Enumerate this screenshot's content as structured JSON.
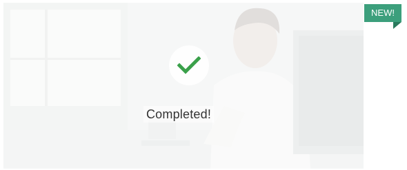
{
  "card": {
    "status_label": "Completed!",
    "status_icon": "checkmark-icon",
    "check_color": "#3aa04a"
  },
  "badge": {
    "label": "NEW!",
    "color": "#3c9f7c"
  },
  "background_image": "office-worker-at-computer-photo"
}
